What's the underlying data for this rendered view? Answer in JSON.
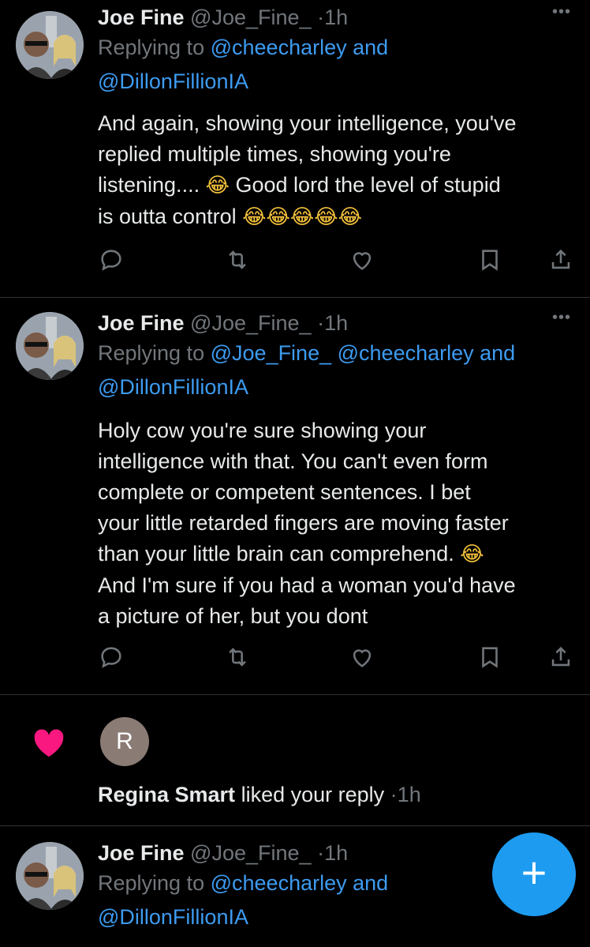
{
  "tweets": [
    {
      "name": "Joe Fine",
      "handle": "@Joe_Fine_",
      "sep": "·",
      "time": "1h",
      "more": "•••",
      "replying_prefix": "Replying to",
      "mentions_line1": "@cheecharley",
      "and": "and",
      "mentions_line2": "@DillonFillionIA",
      "text_lines": [
        "And again, showing your intelligence, you've",
        "replied multiple times, showing you're",
        "listening....",
        "Good lord the level of stupid",
        "is outta control"
      ],
      "emojis": [
        "😂",
        "😂😂😂😂😂"
      ]
    },
    {
      "name": "Joe Fine",
      "handle": "@Joe_Fine_",
      "sep": "·",
      "time": "1h",
      "more": "•••",
      "replying_prefix": "Replying to",
      "mentions_line1a": "@Joe_Fine_",
      "mentions_line1b": "@cheecharley",
      "and": "and",
      "mentions_line2": "@DillonFillionIA",
      "text_lines": [
        "Holy cow you're sure showing your",
        "intelligence with that. You can't even form",
        "complete or competent sentences. I bet",
        "your little retarded fingers are moving faster",
        "than your little brain can comprehend.",
        "And I'm sure if you had a woman you'd have",
        "a picture of her, but you dont"
      ],
      "emojis": [
        "😂"
      ]
    },
    {
      "name": "Joe Fine",
      "handle": "@Joe_Fine_",
      "sep": "·",
      "time": "1h",
      "replying_prefix": "Replying to",
      "mentions_line1": "@cheecharley",
      "and": "and",
      "mentions_line2": "@DillonFillionIA"
    }
  ],
  "like_notification": {
    "avatar_letter": "R",
    "liker_name": "Regina Smart",
    "action_text": "liked your reply",
    "sep": "·",
    "time": "1h"
  },
  "fab_label": "+",
  "colors": {
    "background": "#000000",
    "text": "#e7e9ea",
    "muted": "#71767b",
    "mention": "#3d9bf0",
    "heart": "#f91880",
    "fab": "#1d9bf0"
  },
  "icons": [
    "reply-icon",
    "retweet-icon",
    "like-icon",
    "bookmark-icon",
    "share-icon",
    "more-icon",
    "heart-icon",
    "compose-plus-icon"
  ]
}
